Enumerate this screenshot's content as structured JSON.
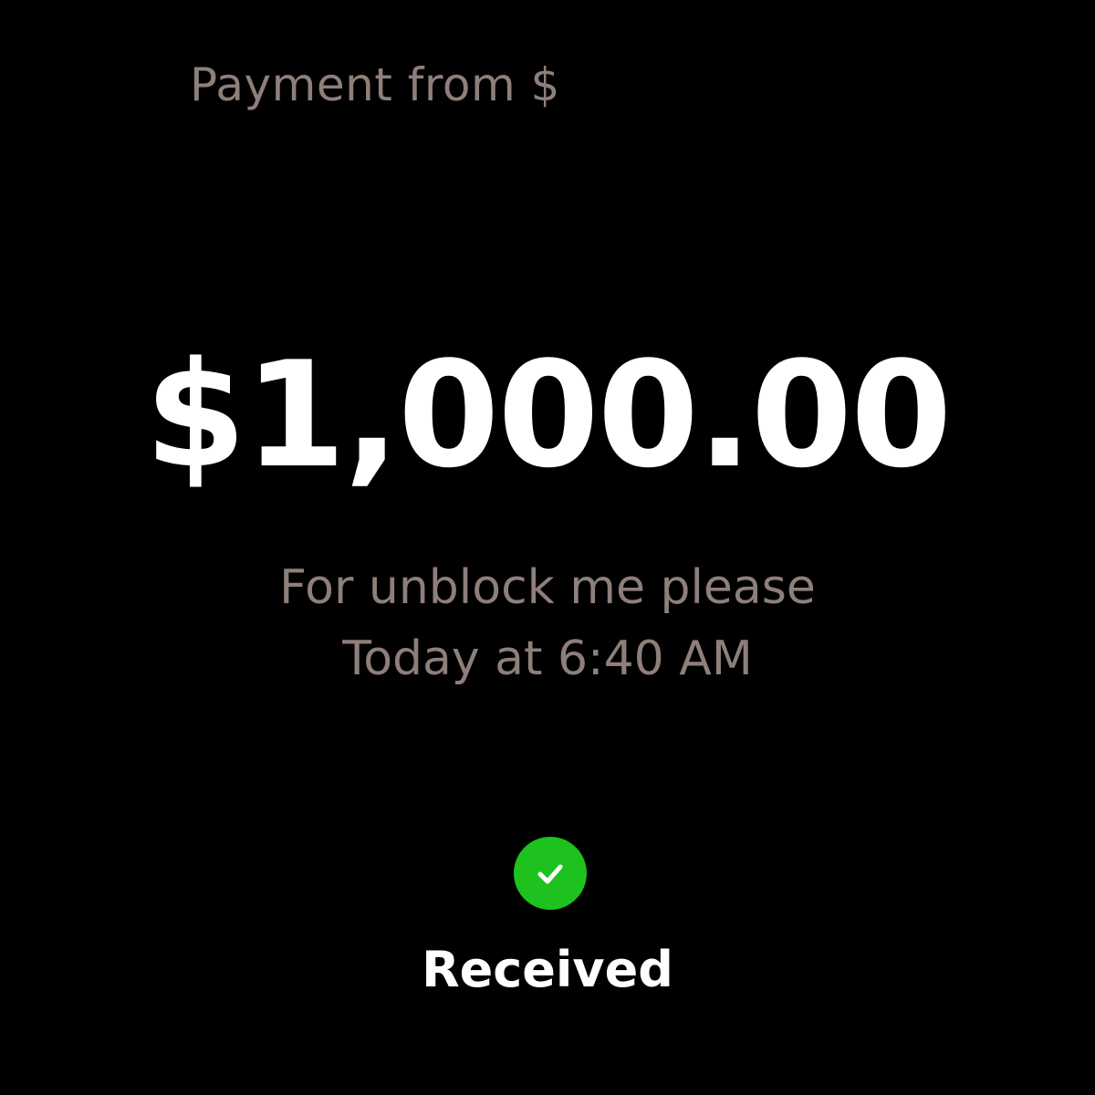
{
  "payment": {
    "header": "Payment from $",
    "amount": "$1,000.00",
    "note": "For unblock me please",
    "timestamp": "Today at 6:40 AM",
    "status_label": "Received",
    "status_icon": "check-circle-icon"
  },
  "colors": {
    "background": "#000000",
    "muted_text": "#8e7f7a",
    "primary_text": "#ffffff",
    "success": "#1ec21e"
  }
}
